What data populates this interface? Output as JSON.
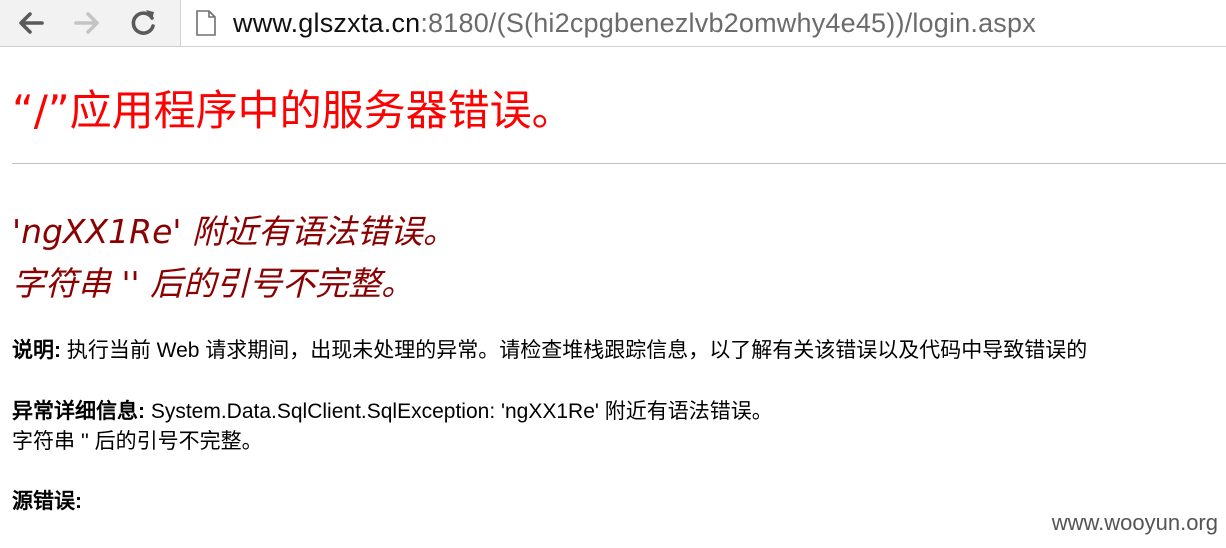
{
  "browser": {
    "url_host": "www.glszxta.cn",
    "url_rest": ":8180/(S(hi2cpgbenezlvb2omwhy4e45))/login.aspx"
  },
  "page": {
    "title": "“/”应用程序中的服务器错误。",
    "error_line1": "'ngXX1Re' 附近有语法错误。",
    "error_line2": "字符串 '' 后的引号不完整。",
    "description_label": "说明:",
    "description_text": " 执行当前 Web 请求期间，出现未处理的异常。请检查堆栈跟踪信息，以了解有关该错误以及代码中导致错误的",
    "exception_label": "异常详细信息:",
    "exception_text": " System.Data.SqlClient.SqlException: 'ngXX1Re' 附近有语法错误。",
    "exception_line2": "字符串 '' 后的引号不完整。",
    "source_label": "源错误:"
  },
  "watermark": "www.wooyun.org",
  "icons": {
    "back": "back-arrow-icon",
    "forward": "forward-arrow-icon",
    "reload": "reload-icon",
    "page": "page-icon"
  },
  "colors": {
    "title": "#ff0000",
    "error": "#8b0000",
    "toolbar_bg": "#f2f2f2"
  }
}
